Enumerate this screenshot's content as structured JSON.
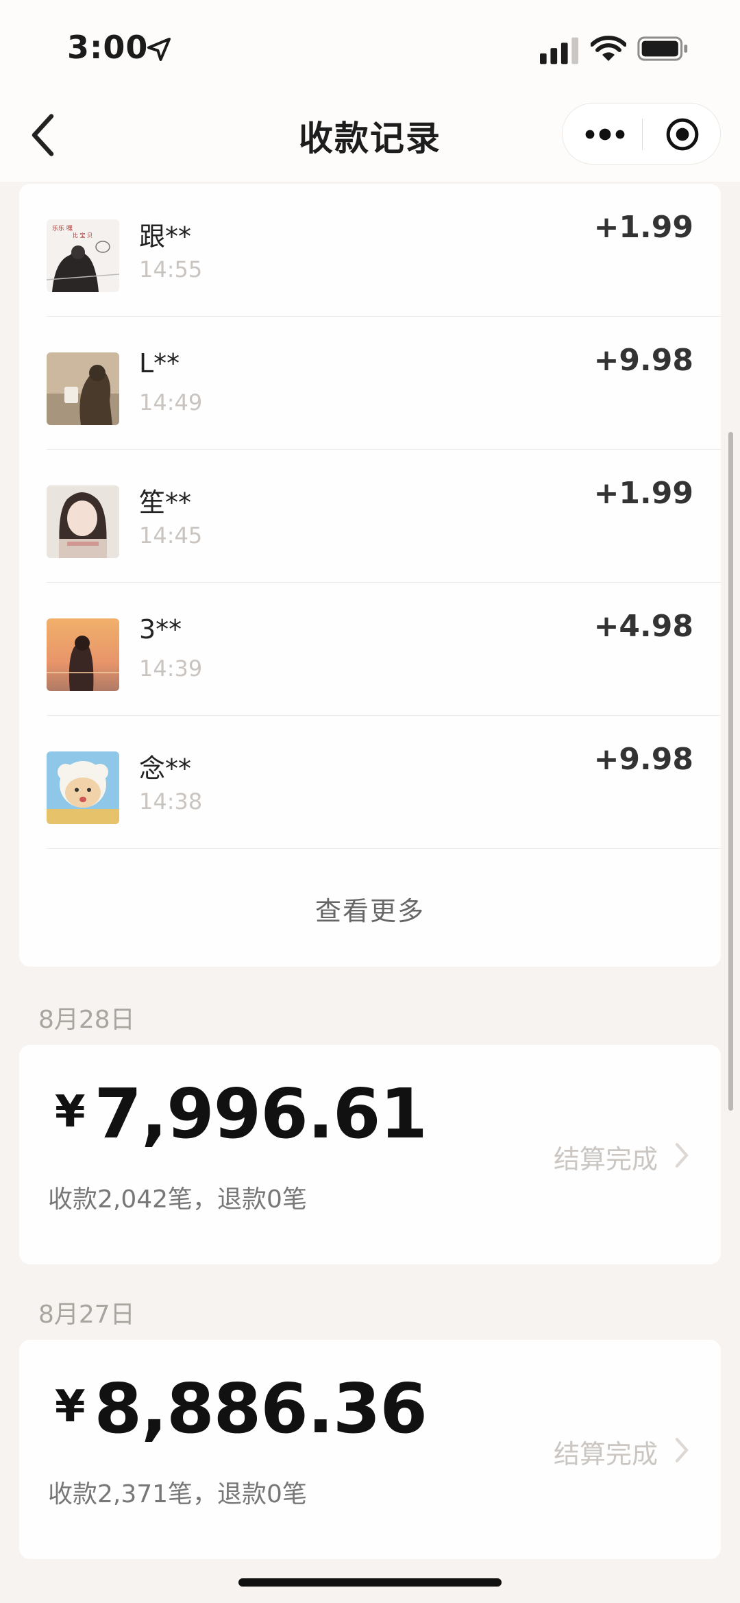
{
  "status_bar": {
    "time": "3:00"
  },
  "nav": {
    "title": "收款记录"
  },
  "records": [
    {
      "name": "跟**",
      "time": "14:55",
      "amount": "+1.99",
      "avatar": "avatar-girl-illustration"
    },
    {
      "name": "L**",
      "time": "14:49",
      "amount": "+9.98",
      "avatar": "avatar-cat-photo"
    },
    {
      "name": "笙**",
      "time": "14:45",
      "amount": "+1.99",
      "avatar": "avatar-girl-portrait"
    },
    {
      "name": "3**",
      "time": "14:39",
      "amount": "+4.98",
      "avatar": "avatar-sunset-photo"
    },
    {
      "name": "念**",
      "time": "14:38",
      "amount": "+9.98",
      "avatar": "avatar-cartoon-sheep"
    }
  ],
  "view_more": "查看更多",
  "days": [
    {
      "date": "8月28日",
      "currency": "¥",
      "total": "7,996.61",
      "sub": "收款2,042笔，退款0笔",
      "status": "结算完成"
    },
    {
      "date": "8月27日",
      "currency": "¥",
      "total": "8,886.36",
      "sub": "收款2,371笔，退款0笔",
      "status": "结算完成"
    }
  ],
  "icons": [
    "location-arrow-icon",
    "signal-icon",
    "wifi-icon",
    "battery-icon",
    "back-icon",
    "more-icon",
    "target-icon",
    "chevron-right-icon"
  ]
}
